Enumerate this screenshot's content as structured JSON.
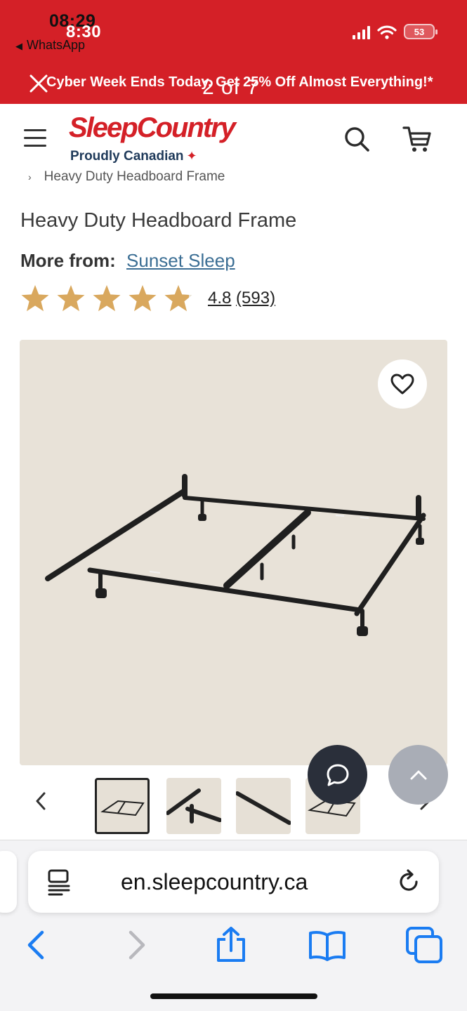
{
  "status_bar": {
    "time_overlay": "08:29",
    "time": "8:30",
    "back_app": "WhatsApp",
    "battery": "53"
  },
  "promo": {
    "text": "Cyber Week Ends Today. Get 25% Off Almost Everything!*",
    "gallery_counter": "2 of 7"
  },
  "header": {
    "logo": "SleepCountry",
    "tagline": "Proudly Canadian"
  },
  "product": {
    "breadcrumb": "Heavy Duty Headboard Frame",
    "title": "Heavy Duty Headboard Frame",
    "more_from_label": "More from:",
    "brand": "Sunset Sleep",
    "rating_value": "4.8",
    "review_count": "(593)",
    "stars": 5,
    "rating_fraction": 0.96
  },
  "gallery": {
    "thumbnail_count": 4,
    "active_index": 0
  },
  "safari": {
    "url": "en.sleepcountry.ca"
  },
  "colors": {
    "brand_red": "#d42027",
    "link_blue": "#3b6e94",
    "star_gold": "#d9a85e",
    "safari_blue": "#1a7cf2"
  }
}
